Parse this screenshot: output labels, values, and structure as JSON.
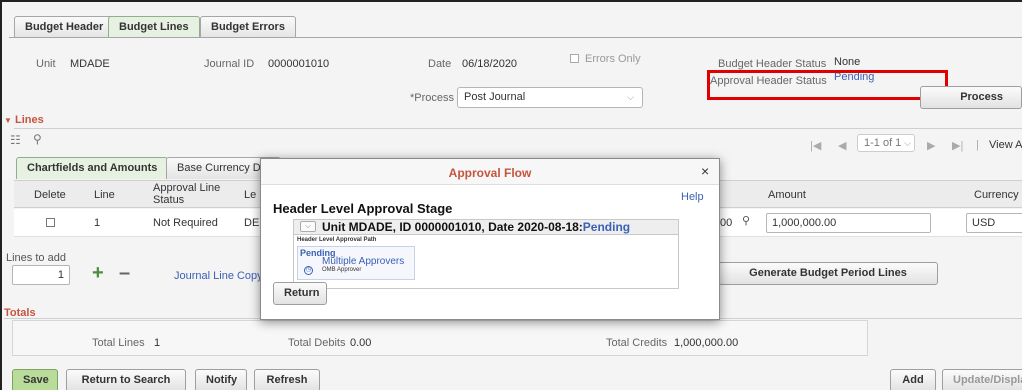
{
  "tabs": [
    {
      "label": "Budget Header",
      "active": false
    },
    {
      "label": "Budget Lines",
      "active": true
    },
    {
      "label": "Budget Errors",
      "active": false
    }
  ],
  "header": {
    "unit_label": "Unit",
    "unit_value": "MDADE",
    "journal_id_label": "Journal ID",
    "journal_id_value": "0000001010",
    "date_label": "Date",
    "date_value": "06/18/2020",
    "errors_only_label": "Errors Only",
    "budget_header_status_label": "Budget Header Status",
    "budget_header_status_value": "None",
    "approval_header_status_label": "Approval Header Status",
    "approval_header_status_value": "Pending",
    "process_label": "*Process",
    "process_value": "Post Journal",
    "process_button": "Process"
  },
  "lines": {
    "title": "Lines",
    "pager": "1-1 of 1",
    "view_all": "View All",
    "subtabs": [
      "Chartfields and Amounts",
      "Base Currency Det"
    ],
    "columns": [
      "Delete",
      "Line",
      "Approval Line Status",
      "Le",
      "Amount",
      "Currency"
    ],
    "row": {
      "line": "1",
      "approval_status": "Not Required",
      "ledger": "DE",
      "amount_prefix": "00",
      "amount": "1,000,000.00",
      "currency": "USD"
    },
    "lines_to_add_label": "Lines to add",
    "lines_to_add_value": "1",
    "journal_line_copy": "Journal Line Copy D",
    "generate_button": "Generate Budget Period Lines"
  },
  "totals": {
    "title": "Totals",
    "total_lines_label": "Total Lines",
    "total_lines_value": "1",
    "total_debits_label": "Total Debits",
    "total_debits_value": "0.00",
    "total_credits_label": "Total Credits",
    "total_credits_value": "1,000,000.00"
  },
  "footer": {
    "save": "Save",
    "return_to_search": "Return to Search",
    "notify": "Notify",
    "refresh": "Refresh",
    "add": "Add",
    "update_display": "Update/Display"
  },
  "modal": {
    "title": "Approval Flow",
    "close": "×",
    "help": "Help",
    "stage": "Header Level Approval Stage",
    "path_head": "Unit MDADE, ID 0000001010, Date 2020-08-18:",
    "path_status": "Pending",
    "path_label": "Header Level Approval Path",
    "step_status": "Pending",
    "approver_link": "Multiple Approvers",
    "approver_role": "OMB Approver",
    "return_button": "Return"
  },
  "colors": {
    "section_title": "#c5553f",
    "active_tab": "#e7f1e2",
    "save_button": "#b9dc9a",
    "link": "#3a61b5",
    "highlight_box": "#e00000"
  }
}
